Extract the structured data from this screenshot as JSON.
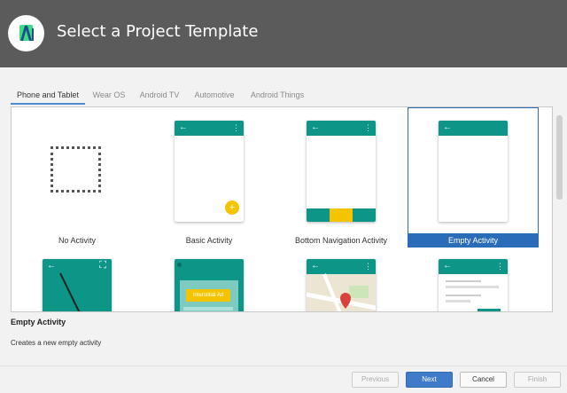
{
  "header": {
    "title": "Select a Project Template"
  },
  "tabs": [
    {
      "label": "Phone and Tablet",
      "active": true
    },
    {
      "label": "Wear OS",
      "active": false
    },
    {
      "label": "Android TV",
      "active": false
    },
    {
      "label": "Automotive",
      "active": false
    },
    {
      "label": "Android Things",
      "active": false
    }
  ],
  "templates": [
    {
      "label": "No Activity"
    },
    {
      "label": "Basic Activity"
    },
    {
      "label": "Bottom Navigation Activity"
    },
    {
      "label": "Empty Activity",
      "selected": true
    }
  ],
  "row2": {
    "interstitial_label": "Interstitial Ad"
  },
  "phone_icons": {
    "back": "←",
    "more": "⋮",
    "fab": "+",
    "expand": "⛶"
  },
  "description": {
    "title": "Empty Activity",
    "text": "Creates a new empty activity"
  },
  "footer": {
    "previous": "Previous",
    "next": "Next",
    "cancel": "Cancel",
    "finish": "Finish"
  },
  "colors": {
    "header": "#5b5b5b",
    "teal": "#0d9688",
    "selection": "#2b6cb8",
    "fab": "#f5c400"
  }
}
